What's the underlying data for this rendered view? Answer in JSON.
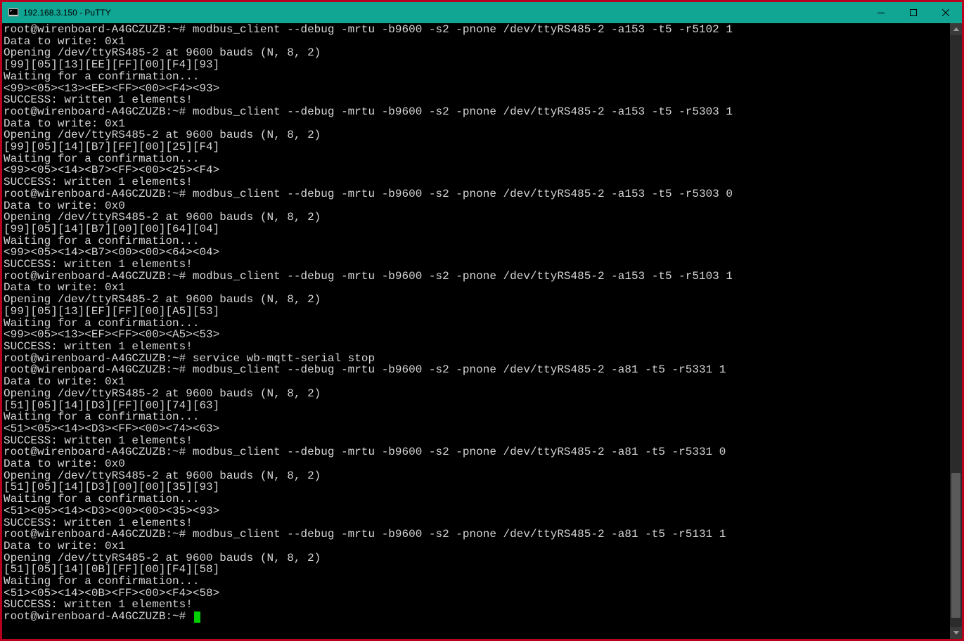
{
  "window": {
    "title": "192.168.3.150 - PuTTY",
    "icon": "putty-icon"
  },
  "terminal": {
    "prompt": "root@wirenboard-A4GCZUZB:~#",
    "lines": [
      "root@wirenboard-A4GCZUZB:~# modbus_client --debug -mrtu -b9600 -s2 -pnone /dev/ttyRS485-2 -a153 -t5 -r5102 1",
      "Data to write: 0x1",
      "Opening /dev/ttyRS485-2 at 9600 bauds (N, 8, 2)",
      "[99][05][13][EE][FF][00][F4][93]",
      "Waiting for a confirmation...",
      "<99><05><13><EE><FF><00><F4><93>",
      "SUCCESS: written 1 elements!",
      "root@wirenboard-A4GCZUZB:~# modbus_client --debug -mrtu -b9600 -s2 -pnone /dev/ttyRS485-2 -a153 -t5 -r5303 1",
      "Data to write: 0x1",
      "Opening /dev/ttyRS485-2 at 9600 bauds (N, 8, 2)",
      "[99][05][14][B7][FF][00][25][F4]",
      "Waiting for a confirmation...",
      "<99><05><14><B7><FF><00><25><F4>",
      "SUCCESS: written 1 elements!",
      "root@wirenboard-A4GCZUZB:~# modbus_client --debug -mrtu -b9600 -s2 -pnone /dev/ttyRS485-2 -a153 -t5 -r5303 0",
      "Data to write: 0x0",
      "Opening /dev/ttyRS485-2 at 9600 bauds (N, 8, 2)",
      "[99][05][14][B7][00][00][64][04]",
      "Waiting for a confirmation...",
      "<99><05><14><B7><00><00><64><04>",
      "SUCCESS: written 1 elements!",
      "root@wirenboard-A4GCZUZB:~# modbus_client --debug -mrtu -b9600 -s2 -pnone /dev/ttyRS485-2 -a153 -t5 -r5103 1",
      "Data to write: 0x1",
      "Opening /dev/ttyRS485-2 at 9600 bauds (N, 8, 2)",
      "[99][05][13][EF][FF][00][A5][53]",
      "Waiting for a confirmation...",
      "<99><05><13><EF><FF><00><A5><53>",
      "SUCCESS: written 1 elements!",
      "root@wirenboard-A4GCZUZB:~# service wb-mqtt-serial stop",
      "root@wirenboard-A4GCZUZB:~# modbus_client --debug -mrtu -b9600 -s2 -pnone /dev/ttyRS485-2 -a81 -t5 -r5331 1",
      "Data to write: 0x1",
      "Opening /dev/ttyRS485-2 at 9600 bauds (N, 8, 2)",
      "[51][05][14][D3][FF][00][74][63]",
      "Waiting for a confirmation...",
      "<51><05><14><D3><FF><00><74><63>",
      "SUCCESS: written 1 elements!",
      "root@wirenboard-A4GCZUZB:~# modbus_client --debug -mrtu -b9600 -s2 -pnone /dev/ttyRS485-2 -a81 -t5 -r5331 0",
      "Data to write: 0x0",
      "Opening /dev/ttyRS485-2 at 9600 bauds (N, 8, 2)",
      "[51][05][14][D3][00][00][35][93]",
      "Waiting for a confirmation...",
      "<51><05><14><D3><00><00><35><93>",
      "SUCCESS: written 1 elements!",
      "root@wirenboard-A4GCZUZB:~# modbus_client --debug -mrtu -b9600 -s2 -pnone /dev/ttyRS485-2 -a81 -t5 -r5131 1",
      "Data to write: 0x1",
      "Opening /dev/ttyRS485-2 at 9600 bauds (N, 8, 2)",
      "[51][05][14][0B][FF][00][F4][58]",
      "Waiting for a confirmation...",
      "<51><05><14><0B><FF><00><F4><58>",
      "SUCCESS: written 1 elements!"
    ],
    "current_prompt": "root@wirenboard-A4GCZUZB:~# "
  }
}
